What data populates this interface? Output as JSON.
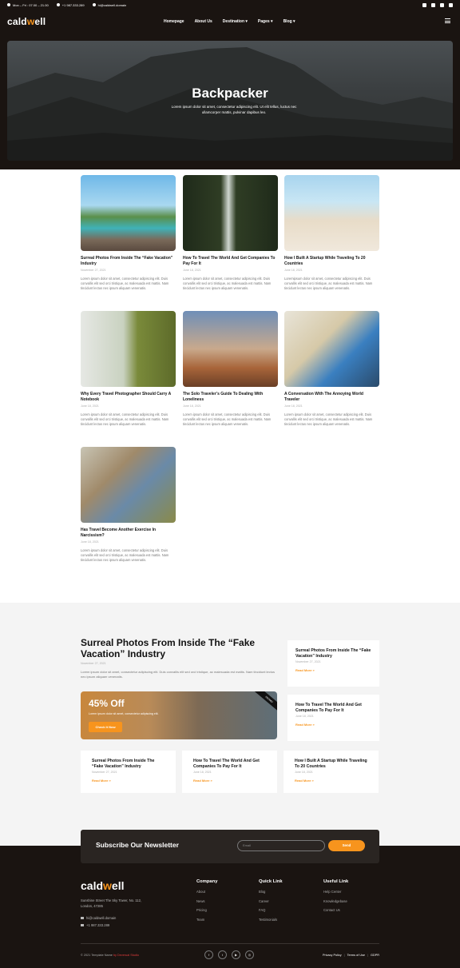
{
  "topbar": {
    "hours": "Mon – Fri : 07.00 – 21.00",
    "phone": "+1 987.333.289",
    "email": "hi@caldwell.domain"
  },
  "header": {
    "logo": "caldwell",
    "nav": [
      "Homepage",
      "About Us",
      "Destination ▾",
      "Pages ▾",
      "Blog ▾"
    ]
  },
  "hero": {
    "title": "Backpacker",
    "subtitle": "Lorem ipsum dolor sit amet, consectetur adipiscing elit. Ut elit tellus, luctus nec ullamcorper mattis, pulvinar dapibus leo."
  },
  "posts": [
    {
      "title": "Surreal Photos From Inside The “Fake Vacation” Industry",
      "date": "November 27, 2021",
      "excerpt": "Lorem ipsum dolor sit amet, consectetur adipiscing elit. Duis convallis elit sed orci tristique, ac malesuada est mattis. Nam tincidunt lectus nec ipsum aliquam venenatis."
    },
    {
      "title": "How To Travel The World And Get Companies To Pay For It",
      "date": "June 18, 2021",
      "excerpt": "Lorem ipsum dolor sit amet, consectetur adipiscing elit. Duis convallis elit sed orci tristique, ac malesuada est mattis. Nam tincidunt lectus nec ipsum aliquam venenatis."
    },
    {
      "title": "How I Built A Startup While Traveling To 20 Countries",
      "date": "June 18, 2021",
      "excerpt": "Loremipsum dolor sit amet, consectetur adipiscing elit. Duis convallis elit sed orci tristique, ac malesuada est mattis. Nam tincidunt lectus nec ipsum aliquam venenatis."
    },
    {
      "title": "Why Every Travel Photographer Should Carry A Notebook",
      "date": "June 18, 2021",
      "excerpt": "Lorem ipsum dolor sit amet, consectetur adipiscing elit. Duis convallis elit sed orci tristique, ac malesuada est mattis. Nam tincidunt lectus nec ipsum aliquam venenatis."
    },
    {
      "title": "The Solo Traveler’s Guide To Dealing With Loneliness",
      "date": "June 18, 2021",
      "excerpt": "Lorem ipsum dolor sit amet, consectetur adipiscing elit. Duis convallis elit sed orci tristique, ac malesuada est mattis. Nam tincidunt lectus nec ipsum aliquam venenatis."
    },
    {
      "title": "A Conversation With The Annoying World Traveler",
      "date": "June 18, 2021",
      "excerpt": "Lorem ipsum dolor sit amet, consectetur adipiscing elit. Duis convallis elit sed orci tristique, ac malesuada est mattis. Nam tincidunt lectus nec ipsum aliquam venenatis."
    },
    {
      "title": "Has Travel Become Another Exercise In Narcissism?",
      "date": "June 18, 2021",
      "excerpt": "Lorem ipsum dolor sit amet, consectetur adipiscing elit. Duis convallis elit sed orci tristique, ac malesuada est mattis. Nam tincidunt lectus nec ipsum aliquam venenatis."
    }
  ],
  "featured": {
    "title": "Surreal Photos From Inside The “Fake Vacation” Industry",
    "date": "November 27, 2021",
    "excerpt": "Lorem ipsum dolor sit amet, consectetur adipiscing elit. Duis convallis elit sed orci tristique, ac malesuada est mattis. Nam tincidunt lectus nec ipsum aliquam venenatis."
  },
  "promo": {
    "percent": "45% Off",
    "text": "Lorem ipsum dolor sit amet, consectetur adipiscing elit.",
    "button": "Check It Now",
    "tag": "PROMO"
  },
  "side_posts": [
    {
      "title": "Surreal Photos From Inside The “Fake Vacation” Industry",
      "date": "November 27, 2021",
      "link": "Read More »"
    },
    {
      "title": "How To Travel The World And Get Companies To Pay For It",
      "date": "June 18, 2021",
      "link": "Read More »"
    }
  ],
  "bottom_posts": [
    {
      "title": "Surreal Photos From Inside The “Fake Vacation” Industry",
      "date": "November 27, 2021",
      "link": "Read More »"
    },
    {
      "title": "How To Travel The World And Get Companies To Pay For It",
      "date": "June 18, 2021",
      "link": "Read More »"
    },
    {
      "title": "How I Built A Startup While Traveling To 20 Countries",
      "date": "June 18, 2021",
      "link": "Read More »"
    }
  ],
  "newsletter": {
    "title": "Subscribe Our Newsletter",
    "placeholder": "Email",
    "button": "Send"
  },
  "footer": {
    "logo": "caldwell",
    "address": "Sunshine Street The Sky Tower, No. 112, London, 47285",
    "email": "hi@caldwell.domain",
    "phone": "+1 987.333.289",
    "columns": [
      {
        "title": "Company",
        "items": [
          "About",
          "News",
          "Pricing",
          "Team"
        ]
      },
      {
        "title": "Quick Link",
        "items": [
          "Blog",
          "Career",
          "FAQ",
          "Testimonials"
        ]
      },
      {
        "title": "Useful Link",
        "items": [
          "Help Center",
          "Knowledgebase",
          "Contact Us"
        ]
      }
    ],
    "copyright": "© 2021 Template Name",
    "copyright_by": "by Deverual Studio",
    "legal": [
      "Privacy Policy",
      "Terms of Use",
      "GDPR"
    ]
  },
  "colors": {
    "accent": "#f7941d",
    "dark": "#1a1411",
    "section_bg": "#f4f4f4"
  }
}
